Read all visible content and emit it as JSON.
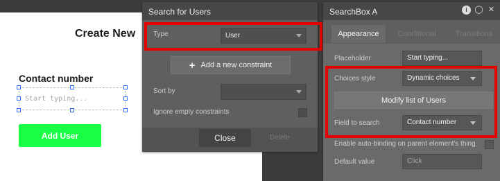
{
  "canvas": {
    "title": "Create New",
    "contact_label": "Contact number",
    "search_placeholder": "Start typing...",
    "add_user_label": "Add User",
    "add_user_color": "#19ff45"
  },
  "search_panel": {
    "title": "Search for Users",
    "type_label": "Type",
    "type_value": "User",
    "add_constraint": "Add a new constraint",
    "sort_by_label": "Sort by",
    "sort_by_value": "",
    "ignore_empty_label": "Ignore empty constraints",
    "close_label": "Close",
    "delete_label": "Delete"
  },
  "property_panel": {
    "title": "SearchBox A",
    "icons": [
      "info-icon",
      "comment-icon",
      "close-icon"
    ],
    "tabs": [
      "Appearance",
      "Conditional",
      "Transitions"
    ],
    "active_tab": "Appearance",
    "placeholder_label": "Placeholder",
    "placeholder_value": "Start typing...",
    "choices_style_label": "Choices style",
    "choices_style_value": "Dynamic choices",
    "modify_list_label": "Modify list of Users",
    "field_to_search_label": "Field to search",
    "field_to_search_value": "Contact number",
    "auto_binding_label": "Enable auto-binding on parent element's thing",
    "default_value_label": "Default value",
    "default_value_placeholder": "Click"
  },
  "highlight_color": "#e50000"
}
